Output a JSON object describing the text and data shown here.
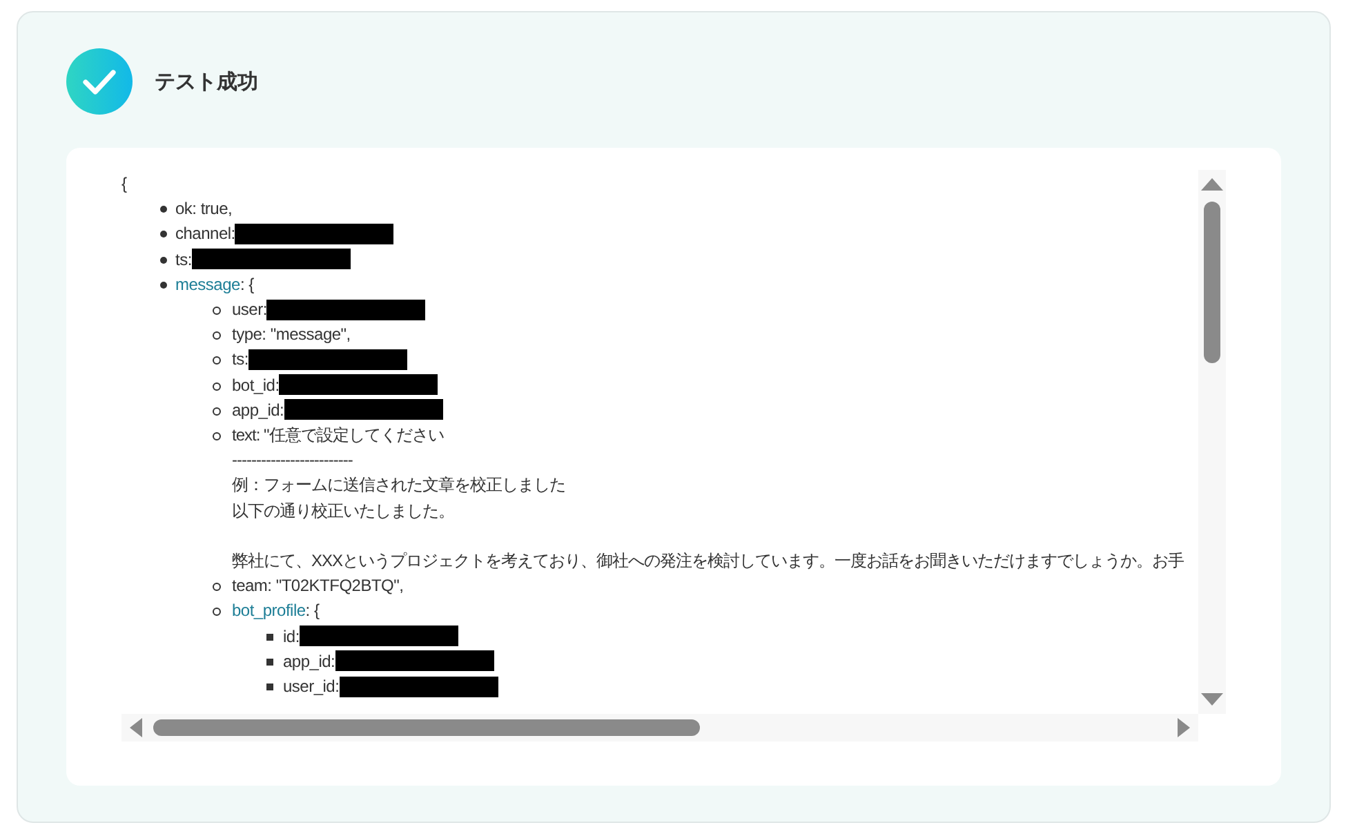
{
  "header": {
    "title": "テスト成功"
  },
  "output": {
    "open": "{",
    "items": [
      {
        "label": "ok: true,"
      },
      {
        "label": "channel:",
        "redacted": true
      },
      {
        "label": "ts:",
        "redacted": true
      },
      {
        "key": "message",
        "open": ": {",
        "children": [
          {
            "label": "user:",
            "redacted": true
          },
          {
            "label": "type: \"message\","
          },
          {
            "label": "ts:",
            "redacted": true
          },
          {
            "label": "bot_id:",
            "redacted": true
          },
          {
            "label": "app_id:",
            "redacted": true
          },
          {
            "paragraphs": [
              [
                "text: \"任意で設定してください",
                "-------------------------",
                "例：フォームに送信された文章を校正しました",
                "以下の通り校正いたしました。"
              ],
              [
                "弊社にて、XXXというプロジェクトを考えており、御社への発注を検討しています。一度お話をお聞きいただけますでしょうか。お手"
              ]
            ]
          },
          {
            "label": "team: \"T02KTFQ2BTQ\","
          },
          {
            "key": "bot_profile",
            "open": ": {",
            "children": [
              {
                "label": "id:",
                "redacted": true
              },
              {
                "label": "app_id:",
                "redacted": true
              },
              {
                "label": "user_id:",
                "redacted": true
              }
            ]
          }
        ]
      }
    ]
  }
}
